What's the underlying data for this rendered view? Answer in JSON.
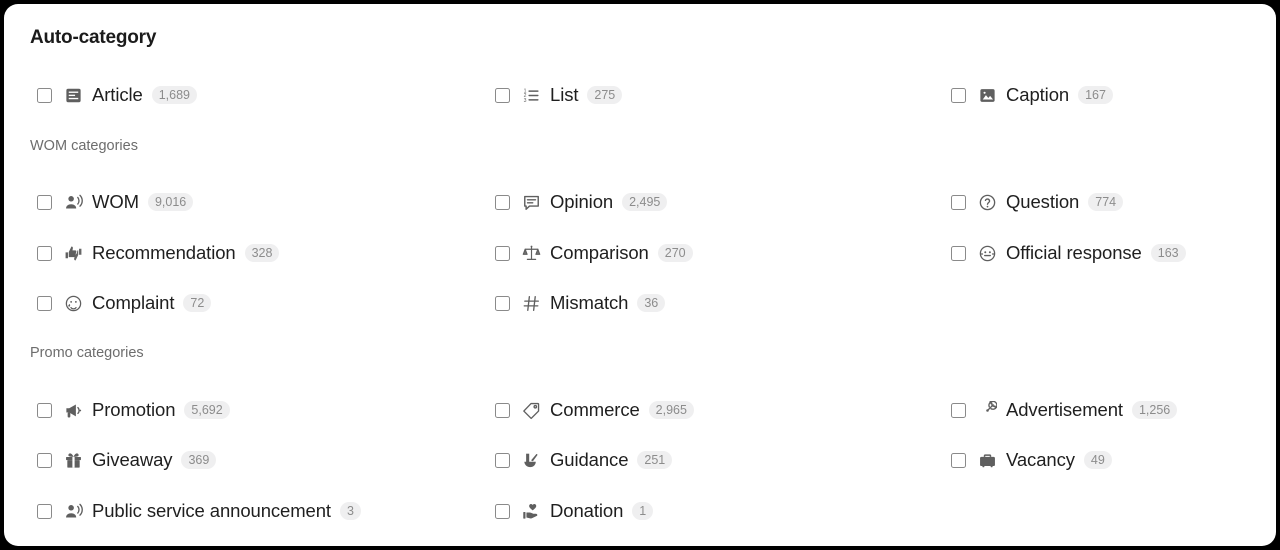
{
  "panel": {
    "title": "Auto-category"
  },
  "groups": {
    "wom_label": "WOM categories",
    "promo_label": "Promo categories"
  },
  "colors": {
    "card_background": "#ffffff",
    "page_background": "#000000",
    "label_text": "#1f1f1f",
    "group_label_text": "#6d6d6d",
    "icon": "#5f5f5f",
    "badge_background": "#efeff0",
    "badge_text": "#8c8c8c",
    "checkbox_border": "#8a8a8a"
  },
  "auto_category": [
    {
      "icon": "article-icon",
      "label": "Article",
      "count": "1,689",
      "checked": false
    },
    {
      "icon": "ordered-list-icon",
      "label": "List",
      "count": "275",
      "checked": false
    },
    {
      "icon": "image-caption-icon",
      "label": "Caption",
      "count": "167",
      "checked": false
    }
  ],
  "wom_categories": [
    {
      "icon": "record-voice-over-icon",
      "label": "WOM",
      "count": "9,016",
      "checked": false
    },
    {
      "icon": "comment-opinion-icon",
      "label": "Opinion",
      "count": "2,495",
      "checked": false
    },
    {
      "icon": "help-circle-icon",
      "label": "Question",
      "count": "774",
      "checked": false
    },
    {
      "icon": "thumbs-up-down-icon",
      "label": "Recommendation",
      "count": "328",
      "checked": false
    },
    {
      "icon": "balance-scale-icon",
      "label": "Comparison",
      "count": "270",
      "checked": false
    },
    {
      "icon": "support-agent-icon",
      "label": "Official response",
      "count": "163",
      "checked": false
    },
    {
      "icon": "sad-face-icon",
      "label": "Complaint",
      "count": "72",
      "checked": false
    },
    {
      "icon": "hash-tag-icon",
      "label": "Mismatch",
      "count": "36",
      "checked": false
    }
  ],
  "promo_categories": [
    {
      "icon": "megaphone-icon",
      "label": "Promotion",
      "count": "5,692",
      "checked": false
    },
    {
      "icon": "price-tag-icon",
      "label": "Commerce",
      "count": "2,965",
      "checked": false
    },
    {
      "icon": "target-ad-icon",
      "label": "Advertisement",
      "count": "1,256",
      "checked": false
    },
    {
      "icon": "gift-icon",
      "label": "Giveaway",
      "count": "369",
      "checked": false
    },
    {
      "icon": "mortar-pestle-icon",
      "label": "Guidance",
      "count": "251",
      "checked": false
    },
    {
      "icon": "briefcase-icon",
      "label": "Vacancy",
      "count": "49",
      "checked": false
    },
    {
      "icon": "record-voice-over-icon",
      "label": "Public service announcement",
      "count": "3",
      "checked": false
    },
    {
      "icon": "volunteer-heart-icon",
      "label": "Donation",
      "count": "1",
      "checked": false
    }
  ]
}
